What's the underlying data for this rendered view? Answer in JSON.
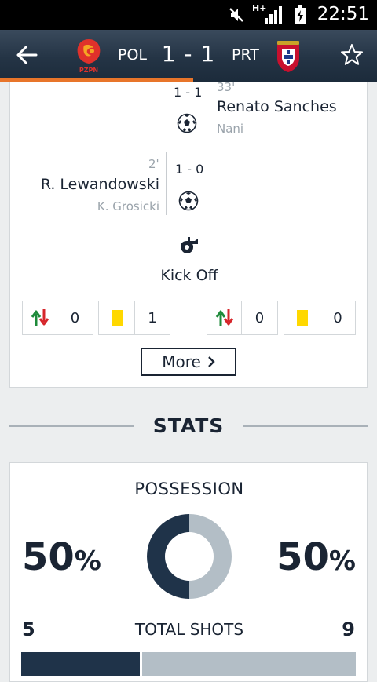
{
  "status_bar": {
    "time": "22:51",
    "network_type": "H+",
    "icons": [
      "mute-icon",
      "signal-icon",
      "battery-icon"
    ]
  },
  "header": {
    "home_team": "POL",
    "away_team": "PRT",
    "score": "1 - 1",
    "home_crest_text": "PZPN",
    "accent_color": "#e8752a"
  },
  "timeline": {
    "events": [
      {
        "minute": "33'",
        "score": "1 - 1",
        "player": "Renato Sanches",
        "assist": "Nani",
        "side": "away",
        "type": "goal"
      },
      {
        "minute": "2'",
        "score": "1 - 0",
        "player": "R. Lewandowski",
        "assist": "K. Grosicki",
        "side": "home",
        "type": "goal"
      }
    ],
    "kickoff_label": "Kick Off",
    "home_stats": {
      "substitutions": "0",
      "yellow_cards": "1"
    },
    "away_stats": {
      "substitutions": "0",
      "yellow_cards": "0"
    },
    "more_label": "More"
  },
  "stats": {
    "title": "STATS",
    "possession": {
      "title": "POSSESSION",
      "home_value": "50",
      "away_value": "50",
      "unit": "%",
      "home_fraction": 0.5,
      "home_color": "#1f3349",
      "away_color": "#b3bec6"
    },
    "total_shots": {
      "title": "TOTAL SHOTS",
      "home": "5",
      "away": "9",
      "home_count": 5,
      "away_count": 9
    }
  }
}
